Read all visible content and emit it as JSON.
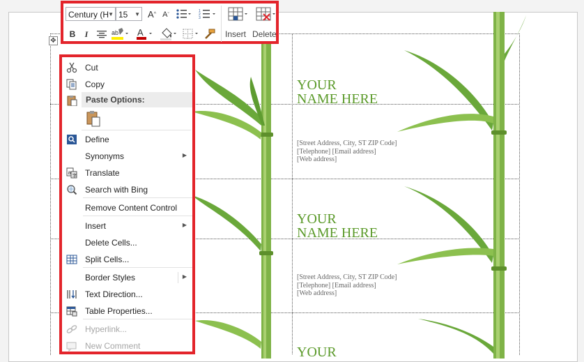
{
  "toolbar": {
    "font_name": "Century (H",
    "font_size": "15",
    "insert_label": "Insert",
    "delete_label": "Delete",
    "colors": {
      "highlight": "#ffee00",
      "font_color": "#c00000"
    }
  },
  "document": {
    "cards": [
      {
        "name": "YOUR\nNAME HERE",
        "address": "[Street Address, City, ST  ZIP Code]",
        "contact": "[Telephone] [Email address]",
        "web": "[Web address]"
      },
      {
        "name": "YOUR\nNAME HERE",
        "address": "[Street Address, City, ST  ZIP Code]",
        "contact": "[Telephone] [Email address]",
        "web": "[Web address]"
      },
      {
        "name": "YOUR"
      }
    ],
    "accent_color": "#5b9a2a"
  },
  "context_menu": {
    "cut": "Cut",
    "copy": "Copy",
    "paste_options": "Paste Options:",
    "define": "Define",
    "synonyms": "Synonyms",
    "translate": "Translate",
    "search_bing": "Search with Bing",
    "remove_content_control": "Remove Content Control",
    "insert": "Insert",
    "delete_cells": "Delete Cells...",
    "split_cells": "Split Cells...",
    "border_styles": "Border Styles",
    "text_direction": "Text Direction...",
    "table_properties": "Table Properties...",
    "hyperlink": "Hyperlink...",
    "new_comment": "New Comment"
  }
}
